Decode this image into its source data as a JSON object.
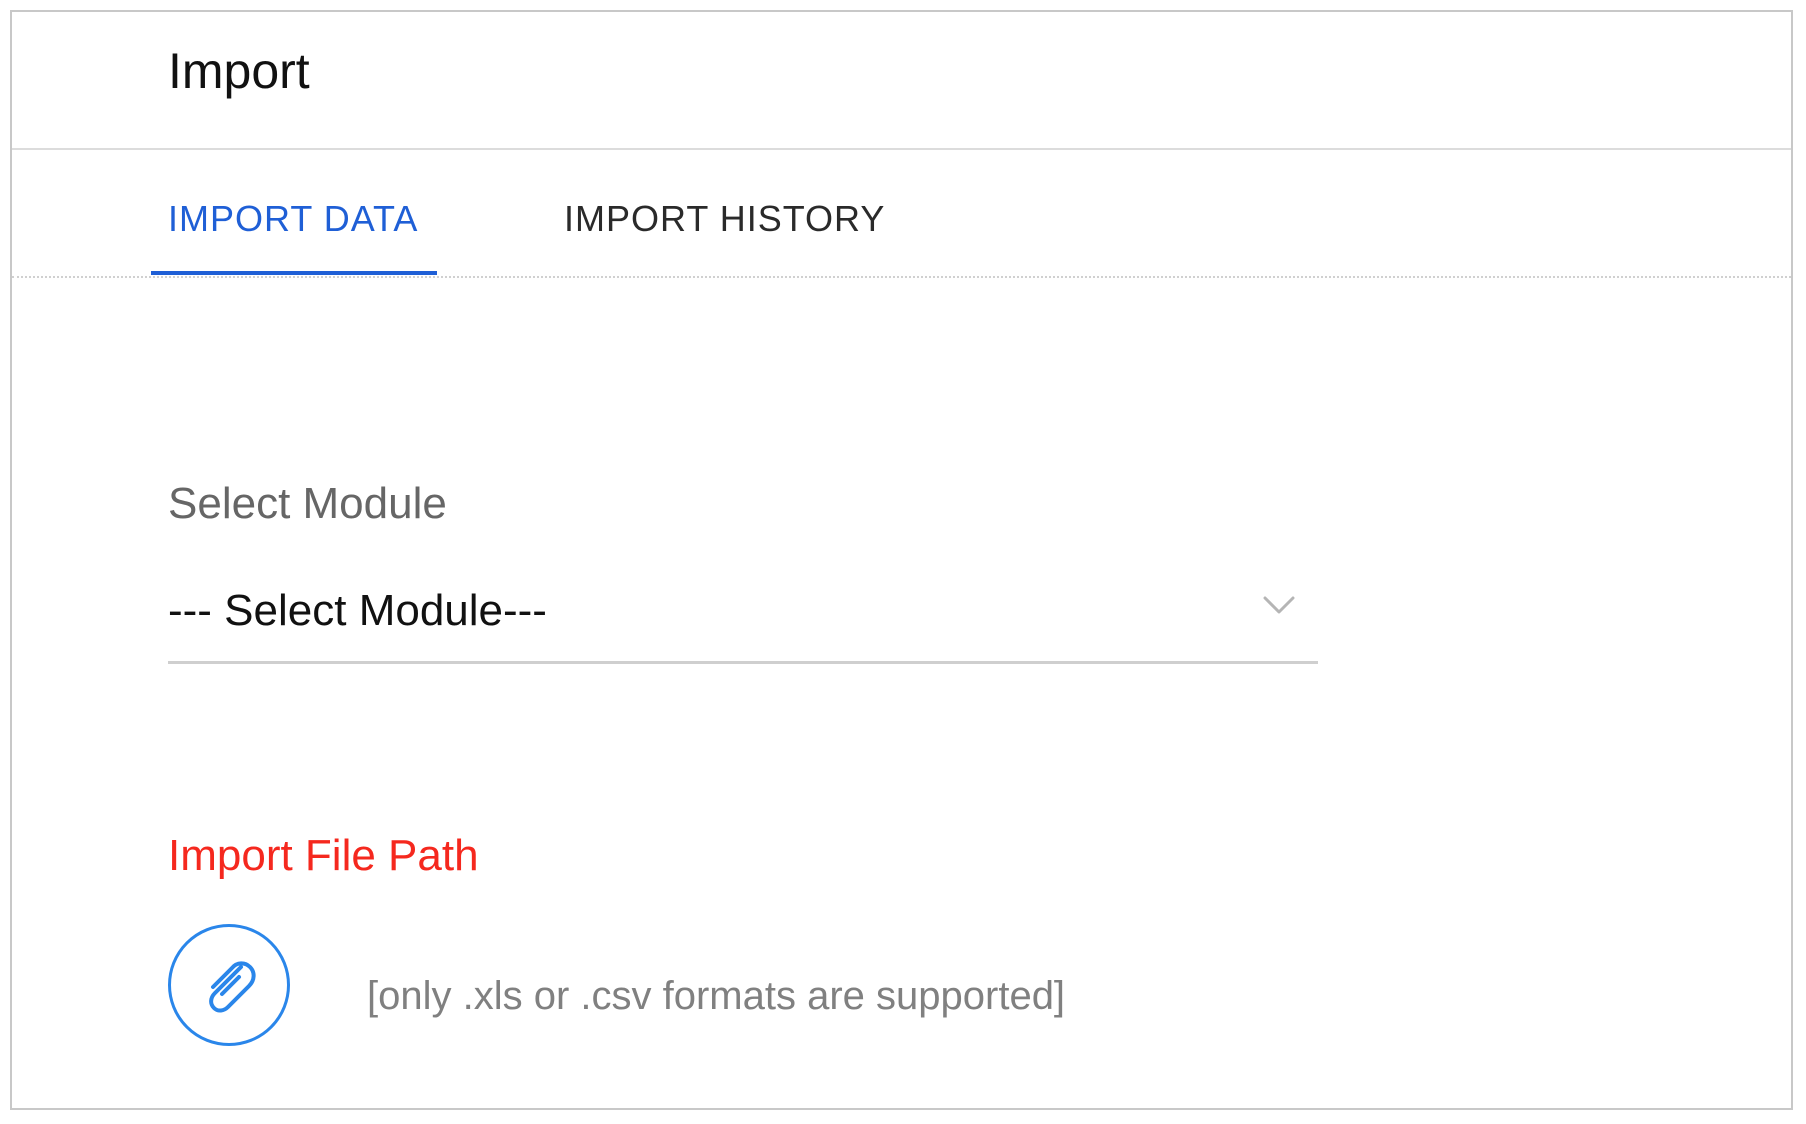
{
  "header": {
    "title": "Import"
  },
  "tabs": [
    {
      "label": "IMPORT DATA",
      "active": true
    },
    {
      "label": "IMPORT HISTORY",
      "active": false
    }
  ],
  "form": {
    "module_label": "Select Module",
    "module_selected": "--- Select Module---",
    "file_label": "Import File Path",
    "file_hint": "[only .xls or .csv formats are supported]"
  },
  "icons": {
    "select_chevron": "chevron-down-icon",
    "attach": "paperclip-icon"
  },
  "colors": {
    "accent": "#1f5fd6",
    "required": "#f5281e",
    "attach_circle": "#2a86ea"
  }
}
